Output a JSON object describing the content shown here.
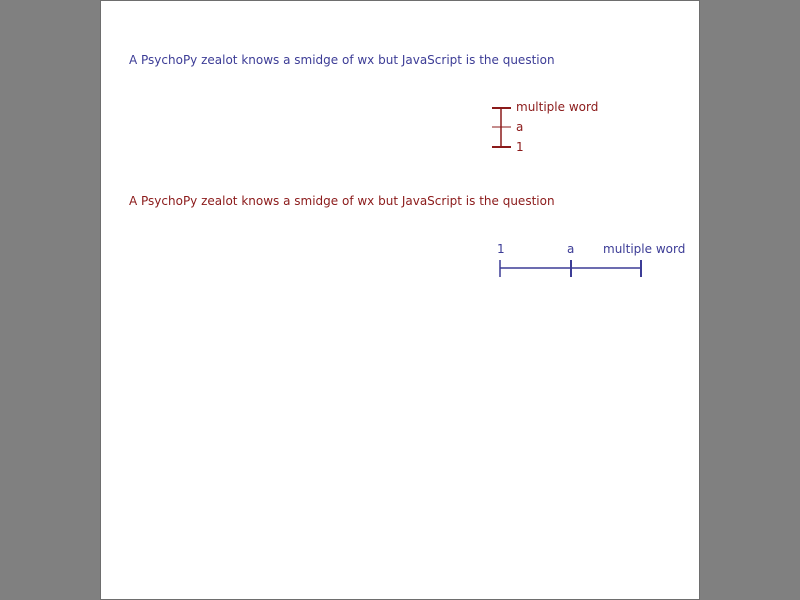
{
  "colors": {
    "background": "#808080",
    "window": "#ffffff",
    "question1": "#3c3c96",
    "question2": "#8b1a1a",
    "slider1": "#8b1a1a",
    "slider2": "#3c3c96"
  },
  "question1": {
    "text": "A PsychoPy zealot knows a smidge of wx but JavaScript is the question"
  },
  "slider1": {
    "orientation": "vertical",
    "labels": [
      "multiple word",
      "a",
      "1"
    ]
  },
  "question2": {
    "text": "A PsychoPy zealot knows a smidge of wx but JavaScript is the question"
  },
  "slider2": {
    "orientation": "horizontal",
    "labels": [
      "1",
      "a",
      "multiple word"
    ]
  }
}
